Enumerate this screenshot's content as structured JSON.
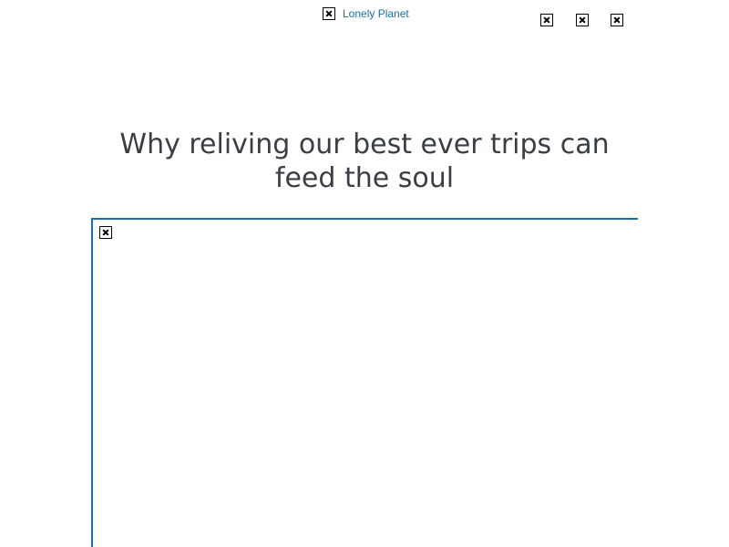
{
  "header": {
    "logo_alt": "Lonely Planet",
    "icons": [
      "broken-image-icon",
      "broken-image-icon",
      "broken-image-icon"
    ]
  },
  "article": {
    "headline": "Why reliving our best ever trips can feed the soul",
    "hero_image_icon": "broken-image-icon"
  },
  "colors": {
    "brand_blue": "#1a6fb3",
    "headline_text": "#3a3f45",
    "background": "#ffffff"
  }
}
